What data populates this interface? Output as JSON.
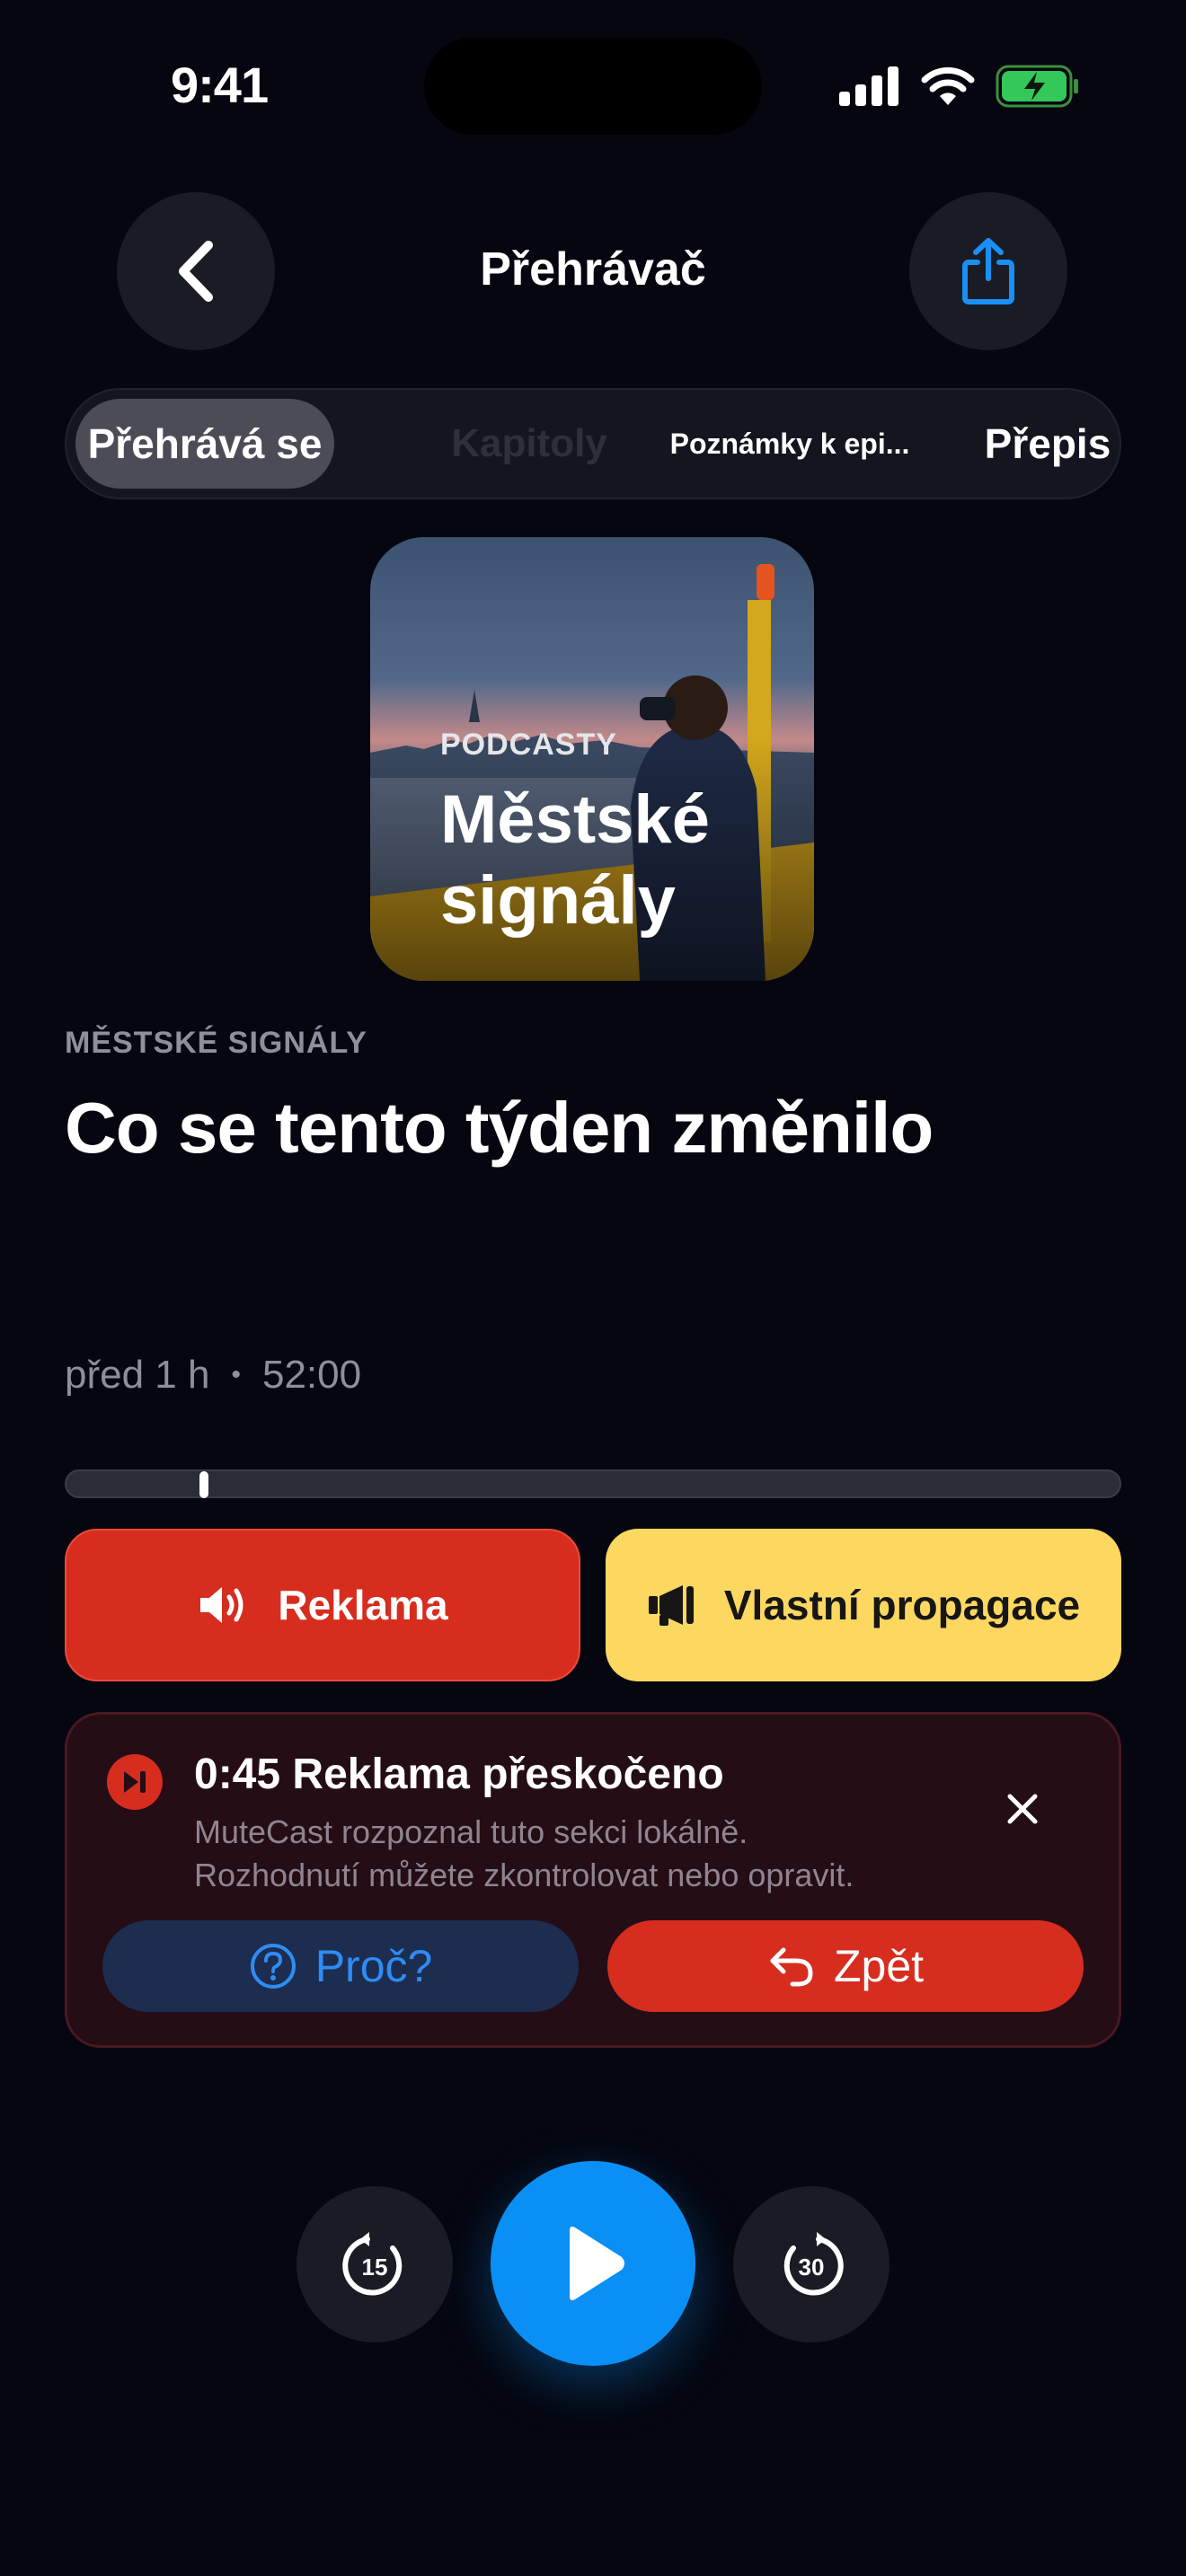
{
  "status_bar": {
    "time": "9:41"
  },
  "nav": {
    "title": "Přehrávač",
    "back_icon": "chevron-left-icon",
    "share_icon": "share-icon"
  },
  "tabs": [
    {
      "label": "Přehrává se",
      "state": "selected"
    },
    {
      "label": "Kapitoly",
      "state": "disabled"
    },
    {
      "label": "Poznámky k epi...",
      "state": "normal"
    },
    {
      "label": "Přepis",
      "state": "normal"
    }
  ],
  "artwork": {
    "kicker": "PODCASTY",
    "title_line1": "Městské",
    "title_line2": "signály"
  },
  "episode": {
    "show": "MĚSTSKÉ SIGNÁLY",
    "title": "Co se tento týden změnilo",
    "age": "před 1 h",
    "separator": "•",
    "duration": "52:00",
    "progress": 0.045
  },
  "segments": {
    "ad_label": "Reklama",
    "promo_label": "Vlastní propagace"
  },
  "skip_card": {
    "title": "0:45 Reklama přeskočeno",
    "desc_line1": "MuteCast rozpoznal tuto sekci lokálně.",
    "desc_line2": "Rozhodnutí můžete zkontrolovat nebo opravit.",
    "why_label": "Proč?",
    "undo_label": "Zpět"
  },
  "transport": {
    "back_seconds": "15",
    "forward_seconds": "30"
  },
  "colors": {
    "background": "#05060f",
    "accent": "#0a8ff5",
    "ad": "#d62d1f",
    "promo": "#fdd860"
  }
}
